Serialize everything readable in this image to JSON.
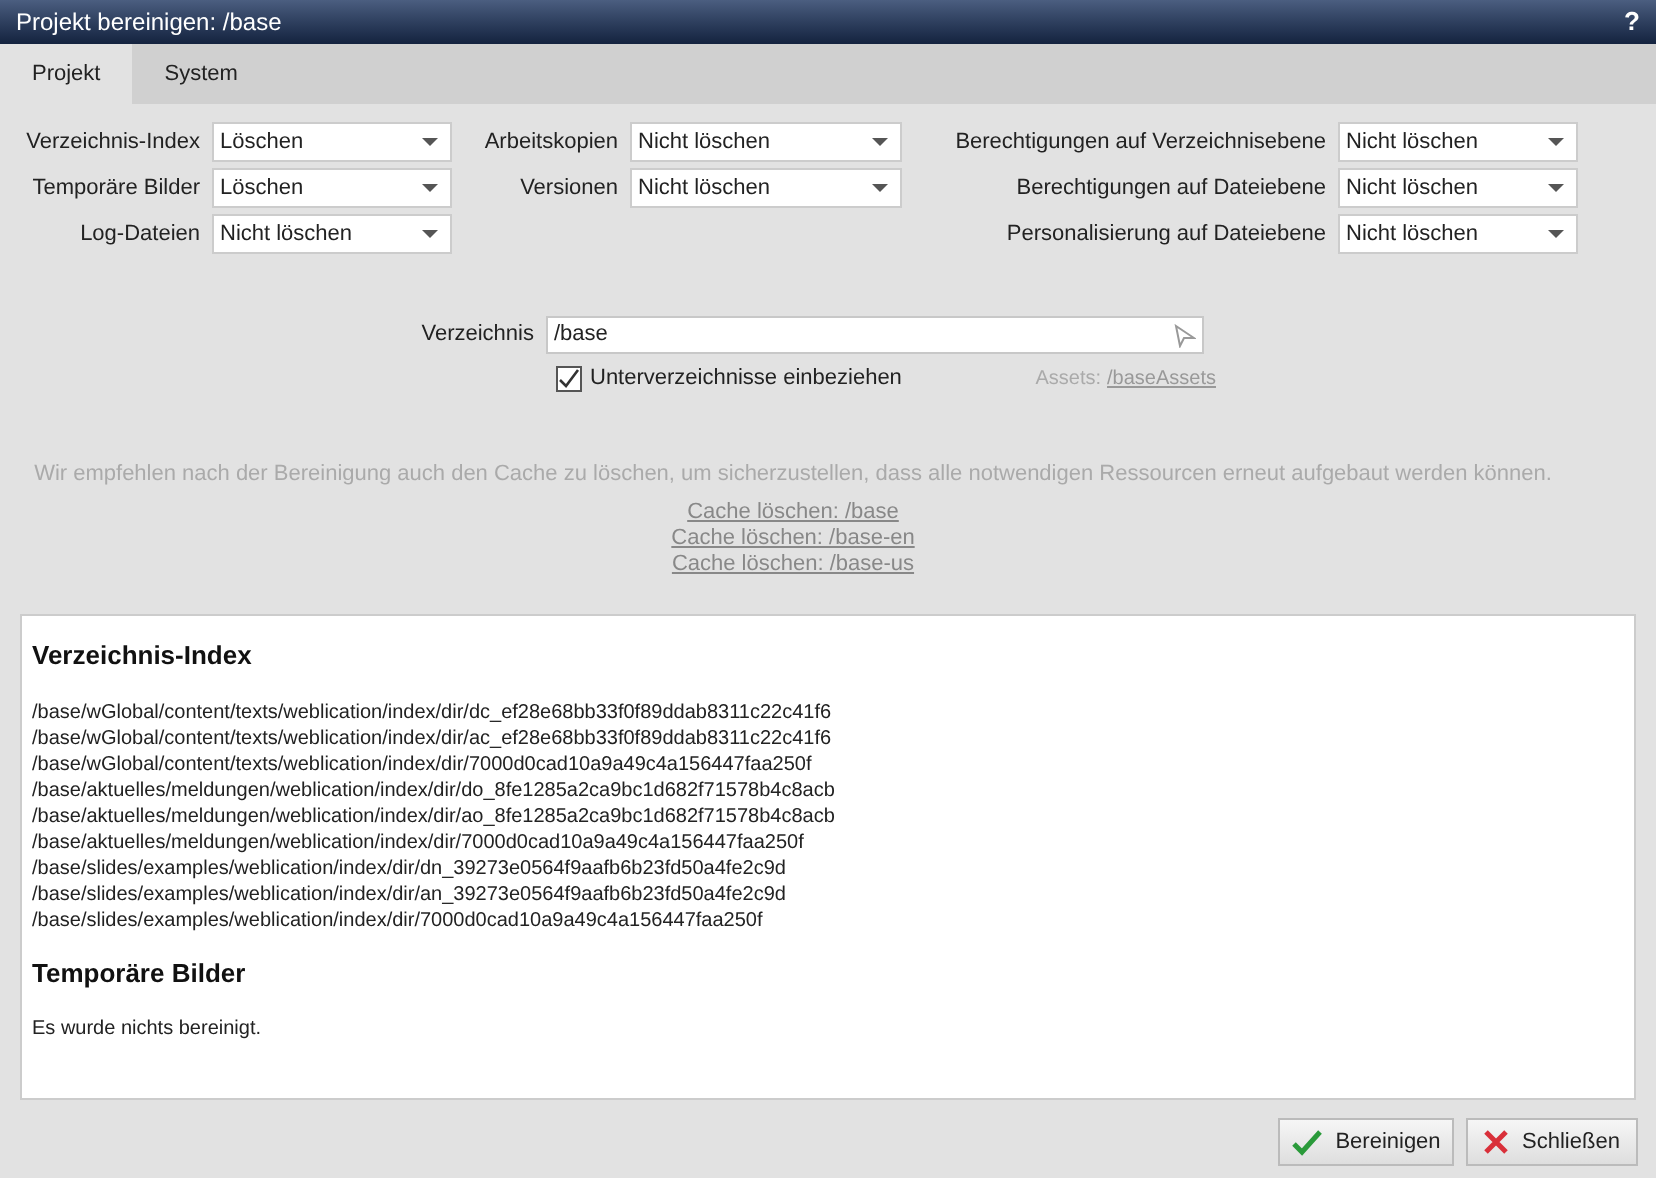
{
  "window": {
    "title": "Projekt bereinigen: /base",
    "help": "?"
  },
  "tabs": [
    {
      "label": "Projekt",
      "selected": true
    },
    {
      "label": "System",
      "selected": false
    }
  ],
  "options": [
    [
      {
        "label": "Verzeichnis-Index",
        "value": "Löschen"
      },
      {
        "label": "Temporäre Bilder",
        "value": "Löschen"
      },
      {
        "label": "Log-Dateien",
        "value": "Nicht löschen"
      }
    ],
    [
      {
        "label": "Arbeitskopien",
        "value": "Nicht löschen"
      },
      {
        "label": "Versionen",
        "value": "Nicht löschen"
      }
    ],
    [
      {
        "label": "Berechtigungen auf Verzeichnisebene",
        "value": "Nicht löschen"
      },
      {
        "label": "Berechtigungen auf Dateiebene",
        "value": "Nicht löschen"
      },
      {
        "label": "Personalisierung auf Dateiebene",
        "value": "Nicht löschen"
      }
    ]
  ],
  "directory": {
    "label": "Verzeichnis",
    "value": "/base"
  },
  "subdirectories": {
    "label": "Unterverzeichnisse einbeziehen",
    "checked": true
  },
  "assets": {
    "label": "Assets:",
    "link": "/baseAssets"
  },
  "hint": "Wir empfehlen nach der Bereinigung auch den Cache zu löschen, um sicherzustellen, dass alle notwendigen Ressourcen erneut aufgebaut werden können.",
  "cache_links": [
    "Cache löschen: /base",
    "Cache löschen: /base-en",
    "Cache löschen: /base-us"
  ],
  "results": [
    {
      "heading": "Verzeichnis-Index",
      "lines": [
        "/base/wGlobal/content/texts/weblication/index/dir/dc_ef28e68bb33f0f89ddab8311c22c41f6",
        "/base/wGlobal/content/texts/weblication/index/dir/ac_ef28e68bb33f0f89ddab8311c22c41f6",
        "/base/wGlobal/content/texts/weblication/index/dir/7000d0cad10a9a49c4a156447faa250f",
        "/base/aktuelles/meldungen/weblication/index/dir/do_8fe1285a2ca9bc1d682f71578b4c8acb",
        "/base/aktuelles/meldungen/weblication/index/dir/ao_8fe1285a2ca9bc1d682f71578b4c8acb",
        "/base/aktuelles/meldungen/weblication/index/dir/7000d0cad10a9a49c4a156447faa250f",
        "/base/slides/examples/weblication/index/dir/dn_39273e0564f9aafb6b23fd50a4fe2c9d",
        "/base/slides/examples/weblication/index/dir/an_39273e0564f9aafb6b23fd50a4fe2c9d",
        "/base/slides/examples/weblication/index/dir/7000d0cad10a9a49c4a156447faa250f"
      ]
    },
    {
      "heading": "Temporäre Bilder",
      "lines": [
        "Es wurde nichts bereinigt."
      ]
    }
  ],
  "buttons": [
    {
      "kind": "confirm",
      "label": "Bereinigen"
    },
    {
      "kind": "close",
      "label": "Schließen"
    }
  ]
}
